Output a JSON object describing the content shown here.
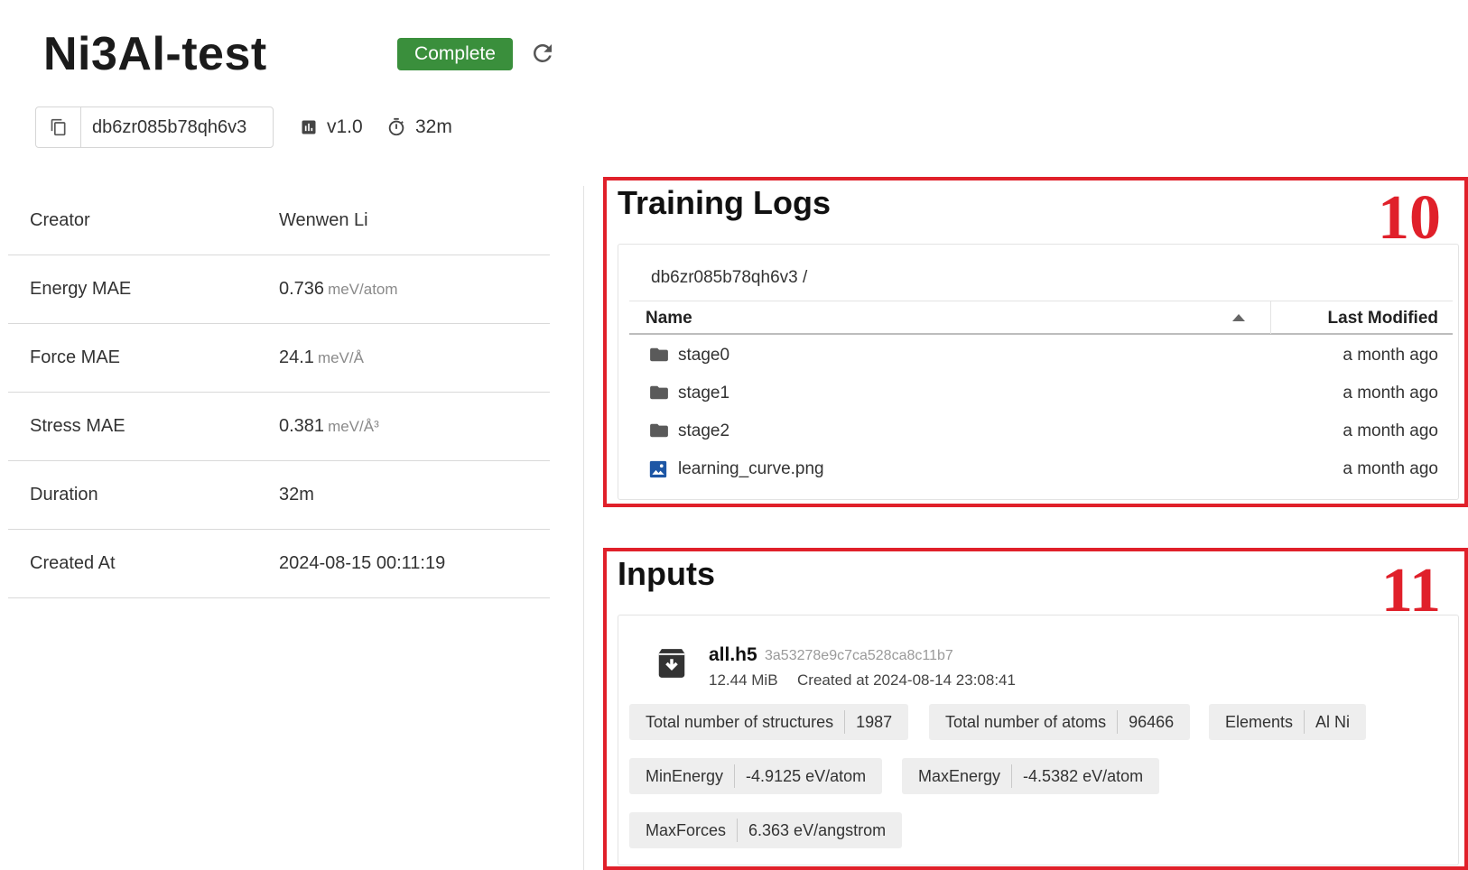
{
  "header": {
    "title": "Ni3Al-test",
    "status": "Complete",
    "status_color": "#3a8f3c",
    "refresh_icon": "refresh-icon"
  },
  "meta": {
    "id": "db6zr085b78qh6v3",
    "copy_icon": "copy-icon",
    "version": "v1.0",
    "version_icon": "chart-icon",
    "duration": "32m",
    "duration_icon": "timer-icon"
  },
  "properties": [
    {
      "label": "Creator",
      "value": "Wenwen Li",
      "unit": ""
    },
    {
      "label": "Energy MAE",
      "value": "0.736",
      "unit": "meV/atom"
    },
    {
      "label": "Force MAE",
      "value": "24.1",
      "unit": "meV/Å"
    },
    {
      "label": "Stress MAE",
      "value": "0.381",
      "unit": "meV/Å³"
    },
    {
      "label": "Duration",
      "value": "32m",
      "unit": ""
    },
    {
      "label": "Created At",
      "value": "2024-08-15 00:11:19",
      "unit": ""
    }
  ],
  "training_logs": {
    "title": "Training Logs",
    "marker": "10",
    "breadcrumb": "db6zr085b78qh6v3 /",
    "columns": {
      "name": "Name",
      "modified": "Last Modified"
    },
    "files": [
      {
        "name": "stage0",
        "modified": "a month ago",
        "icon": "folder-icon"
      },
      {
        "name": "stage1",
        "modified": "a month ago",
        "icon": "folder-icon"
      },
      {
        "name": "stage2",
        "modified": "a month ago",
        "icon": "folder-icon"
      },
      {
        "name": "learning_curve.png",
        "modified": "a month ago",
        "icon": "image-icon"
      }
    ]
  },
  "inputs": {
    "title": "Inputs",
    "marker": "11",
    "dataset": {
      "name": "all.h5",
      "hash": "3a53278e9c7ca528ca8c11b7",
      "size": "12.44 MiB",
      "created": "Created at 2024-08-14 23:08:41",
      "icon": "archive-download-icon"
    },
    "stats": [
      {
        "label": "Total number of structures",
        "value": "1987"
      },
      {
        "label": "Total number of atoms",
        "value": "96466"
      },
      {
        "label": "Elements",
        "value": "Al Ni"
      },
      {
        "label": "MinEnergy",
        "value": "-4.9125 eV/atom"
      },
      {
        "label": "MaxEnergy",
        "value": "-4.5382 eV/atom"
      },
      {
        "label": "MaxForces",
        "value": "6.363 eV/angstrom"
      }
    ]
  },
  "highlight_color": "#e0202a"
}
